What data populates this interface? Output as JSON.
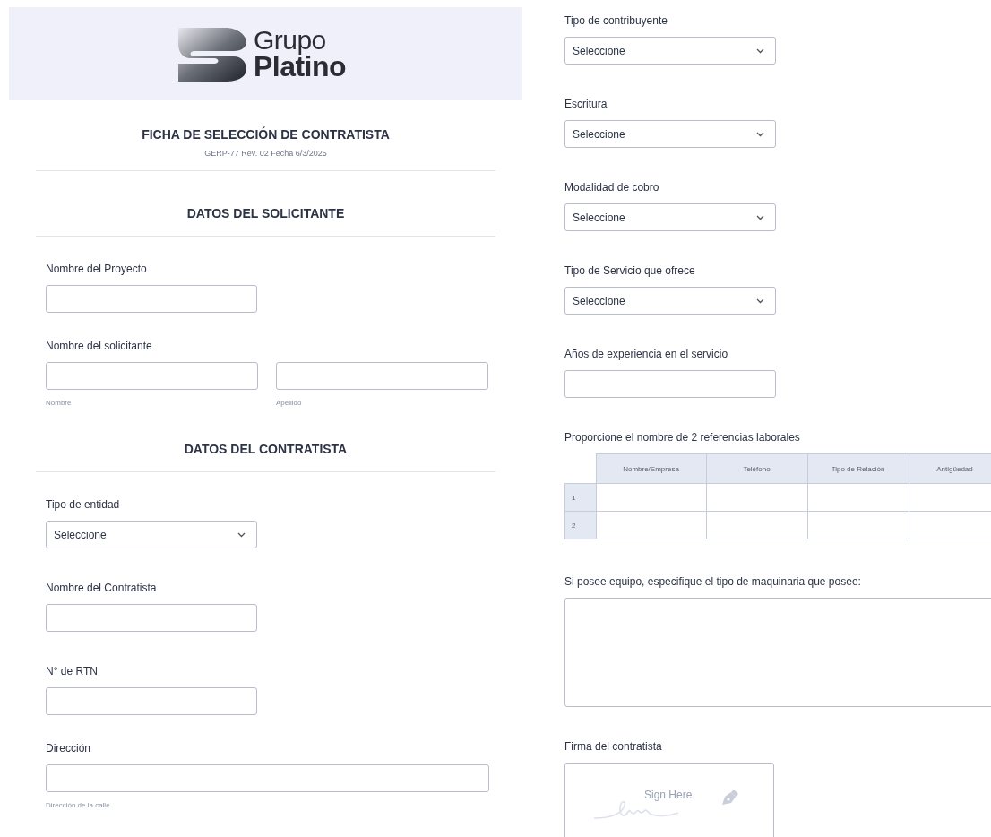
{
  "logo": {
    "line_1": "Grupo",
    "line_2": "Platino"
  },
  "title": "FICHA DE SELECCIÓN DE CONTRATISTA",
  "form_code": "GERP-77 Rev. 02 Fecha 6/3/2025",
  "left_fields": [
    {
      "kind": "heading",
      "label": "DATOS DEL SOLICITANTE"
    },
    {
      "kind": "text",
      "label": "Nombre del Proyecto"
    },
    {
      "kind": "pair",
      "label": "Nombre del solicitante",
      "sublabels": [
        "Nombre",
        "Apellido"
      ]
    },
    {
      "kind": "heading",
      "label": "DATOS DEL CONTRATISTA"
    },
    {
      "kind": "select",
      "label": "Tipo de entidad",
      "value": "Seleccione"
    },
    {
      "kind": "text",
      "label": "Nombre del Contratista"
    },
    {
      "kind": "text",
      "label": "N° de RTN"
    },
    {
      "kind": "wide",
      "label": "Dirección",
      "sublabel": "Dirección de la calle"
    }
  ],
  "right_fields": [
    {
      "kind": "select",
      "label": "Tipo de contribuyente",
      "value": "Seleccione"
    },
    {
      "kind": "select",
      "label": "Escritura",
      "value": "Seleccione"
    },
    {
      "kind": "select",
      "label": "Modalidad de cobro",
      "value": "Seleccione"
    },
    {
      "kind": "select",
      "label": "Tipo de Servicio que ofrece",
      "value": "Seleccione"
    },
    {
      "kind": "text",
      "label": "Años de experiencia en el servicio"
    },
    {
      "kind": "table",
      "label": "Proporcione el nombre de 2 referencias laborales",
      "columns": [
        "Nombre/Empresa",
        "Teléfono",
        "Tipo de Relación",
        "Antigüedad"
      ],
      "rows": [
        "1",
        "2"
      ]
    },
    {
      "kind": "textarea",
      "label": "Si posee equipo, especifique el tipo de maquinaria que posee:"
    },
    {
      "kind": "signature",
      "label": "Firma del contratista",
      "placeholder": "Sign Here"
    }
  ]
}
